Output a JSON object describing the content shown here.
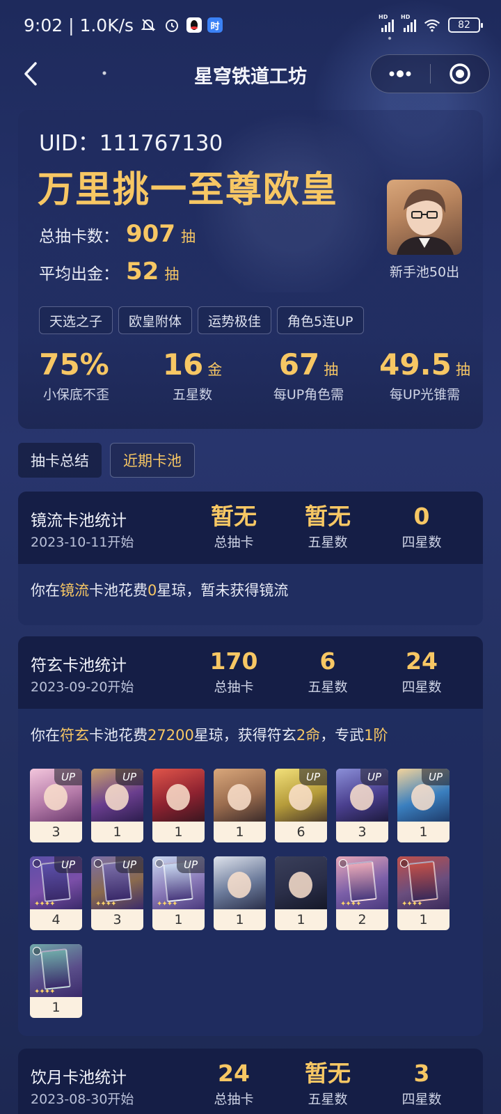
{
  "status_bar": {
    "time_speed": "9:02 | 1.0K/s",
    "app_icon_right_label": "时",
    "battery": "82"
  },
  "nav": {
    "title": "星穹铁道工坊"
  },
  "summary": {
    "uid": "UID：111767130",
    "rank_title": "万里挑一至尊欧皇",
    "total_label": "总抽卡数：",
    "total_value": "907",
    "total_unit": "抽",
    "avg_label": "平均出金：",
    "avg_value": "52",
    "avg_unit": "抽",
    "avatar_caption": "新手池50出",
    "tags": [
      "天选之子",
      "欧皇附体",
      "运势极佳",
      "角色5连UP"
    ],
    "metrics": [
      {
        "value": "75%",
        "unit": "",
        "label": "小保底不歪"
      },
      {
        "value": "16",
        "unit": "金",
        "label": "五星数"
      },
      {
        "value": "67",
        "unit": "抽",
        "label": "每UP角色需"
      },
      {
        "value": "49.5",
        "unit": "抽",
        "label": "每UP光锥需"
      }
    ]
  },
  "tabs": [
    {
      "label": "抽卡总结",
      "active": false
    },
    {
      "label": "近期卡池",
      "active": true
    }
  ],
  "pools": [
    {
      "name": "镜流卡池统计",
      "date": "2023-10-11开始",
      "stats": [
        {
          "value": "暂无",
          "label": "总抽卡"
        },
        {
          "value": "暂无",
          "label": "五星数"
        },
        {
          "value": "0",
          "label": "四星数"
        }
      ],
      "desc": {
        "p1": "你在",
        "h1": "镜流",
        "p2": "卡池花费",
        "h2": "0",
        "p3": "星琼，暂未获得镜流",
        "h3": "",
        "p4": "",
        "h4": "",
        "p5": ""
      }
    },
    {
      "name": "符玄卡池统计",
      "date": "2023-09-20开始",
      "stats": [
        {
          "value": "170",
          "label": "总抽卡"
        },
        {
          "value": "6",
          "label": "五星数"
        },
        {
          "value": "24",
          "label": "四星数"
        }
      ],
      "desc": {
        "p1": "你在",
        "h1": "符玄",
        "p2": "卡池花费",
        "h2": "27200",
        "p3": "星琼，获得符玄",
        "h3": "2命",
        "p4": "，专武",
        "h4": "1阶",
        "p5": ""
      },
      "up_label": "UP",
      "cards": [
        {
          "count": "3",
          "up": true,
          "colors": [
            "#f3c6dc",
            "#b47aa8",
            "#6b3b6e"
          ]
        },
        {
          "count": "1",
          "up": true,
          "colors": [
            "#c9a16a",
            "#6a3e8e",
            "#2c1d4e"
          ]
        },
        {
          "count": "1",
          "up": false,
          "colors": [
            "#e0554a",
            "#8e2230",
            "#3a1620"
          ]
        },
        {
          "count": "1",
          "up": false,
          "colors": [
            "#d9a77b",
            "#9a6c4e",
            "#3b2b2a"
          ]
        },
        {
          "count": "6",
          "up": true,
          "colors": [
            "#f2e07a",
            "#b59b3a",
            "#4b3a2a"
          ]
        },
        {
          "count": "3",
          "up": true,
          "colors": [
            "#8b8fd8",
            "#4a3f8e",
            "#1d1a3e"
          ]
        },
        {
          "count": "1",
          "up": true,
          "colors": [
            "#f3d39a",
            "#3a7fbf",
            "#1e3b6a"
          ]
        },
        {
          "count": "4",
          "up": true,
          "colors": [
            "#5b4fa8",
            "#7b4fa8",
            "#3a2a6a"
          ],
          "lc": true
        },
        {
          "count": "3",
          "up": true,
          "colors": [
            "#7b6fa8",
            "#8a6a4e",
            "#3a2a6a"
          ],
          "lc": true
        },
        {
          "count": "1",
          "up": true,
          "colors": [
            "#c9d8f0",
            "#8a7ab8",
            "#4a3a7e"
          ],
          "lc": true
        },
        {
          "count": "1",
          "up": false,
          "colors": [
            "#dfe3ec",
            "#6b7a9a",
            "#2a2f4a"
          ]
        },
        {
          "count": "1",
          "up": false,
          "colors": [
            "#3a3f5a",
            "#2a2e48",
            "#151828"
          ]
        },
        {
          "count": "2",
          "up": false,
          "colors": [
            "#e8a8b8",
            "#7b5fa8",
            "#4a3a7e"
          ],
          "lc": true
        },
        {
          "count": "1",
          "up": false,
          "colors": [
            "#c0504a",
            "#6a4e7e",
            "#3a2a5a"
          ],
          "lc": true
        },
        {
          "count": "1",
          "up": false,
          "colors": [
            "#6fa8a8",
            "#5a4e8a",
            "#3a2a6a"
          ],
          "lc": true
        }
      ]
    },
    {
      "name": "饮月卡池统计",
      "date": "2023-08-30开始",
      "stats": [
        {
          "value": "24",
          "label": "总抽卡"
        },
        {
          "value": "暂无",
          "label": "五星数"
        },
        {
          "value": "3",
          "label": "四星数"
        }
      ]
    }
  ],
  "colors": {
    "accent_gold": "#f7c764",
    "panel_dark": "#141c42",
    "panel": "#202c60"
  }
}
